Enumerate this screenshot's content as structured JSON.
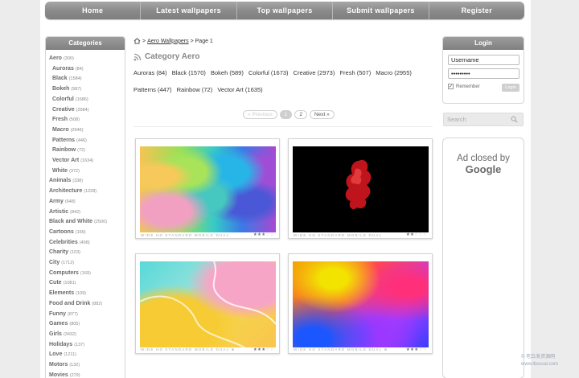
{
  "nav": [
    {
      "label": "Home"
    },
    {
      "label": "Latest wallpapers"
    },
    {
      "label": "Top wallpapers"
    },
    {
      "label": "Submit wallpapers"
    },
    {
      "label": "Register"
    }
  ],
  "categories": {
    "title": "Categories",
    "items": [
      {
        "label": "Aero",
        "count": "(300)",
        "sub": false
      },
      {
        "label": "Auroras",
        "count": "(84)",
        "sub": true
      },
      {
        "label": "Black",
        "count": "(1584)",
        "sub": true
      },
      {
        "label": "Bokeh",
        "count": "(587)",
        "sub": true
      },
      {
        "label": "Colorful",
        "count": "(1686)",
        "sub": true
      },
      {
        "label": "Creative",
        "count": "(2984)",
        "sub": true
      },
      {
        "label": "Fresh",
        "count": "(508)",
        "sub": true
      },
      {
        "label": "Macro",
        "count": "(2946)",
        "sub": true
      },
      {
        "label": "Patterns",
        "count": "(446)",
        "sub": true
      },
      {
        "label": "Rainbow",
        "count": "(72)",
        "sub": true
      },
      {
        "label": "Vector Art",
        "count": "(1634)",
        "sub": true
      },
      {
        "label": "White",
        "count": "(372)",
        "sub": true
      },
      {
        "label": "Animals",
        "count": "(338)",
        "sub": false
      },
      {
        "label": "Architecture",
        "count": "(1228)",
        "sub": false
      },
      {
        "label": "Army",
        "count": "(648)",
        "sub": false
      },
      {
        "label": "Artistic",
        "count": "(842)",
        "sub": false
      },
      {
        "label": "Black and White",
        "count": "(2500)",
        "sub": false
      },
      {
        "label": "Cartoons",
        "count": "(166)",
        "sub": false
      },
      {
        "label": "Celebrities",
        "count": "(498)",
        "sub": false
      },
      {
        "label": "Charity",
        "count": "(103)",
        "sub": false
      },
      {
        "label": "City",
        "count": "(1712)",
        "sub": false
      },
      {
        "label": "Computers",
        "count": "(169)",
        "sub": false
      },
      {
        "label": "Cute",
        "count": "(1081)",
        "sub": false
      },
      {
        "label": "Elements",
        "count": "(109)",
        "sub": false
      },
      {
        "label": "Food and Drink",
        "count": "(882)",
        "sub": false
      },
      {
        "label": "Funny",
        "count": "(877)",
        "sub": false
      },
      {
        "label": "Games",
        "count": "(805)",
        "sub": false
      },
      {
        "label": "Girls",
        "count": "(3432)",
        "sub": false
      },
      {
        "label": "Holidays",
        "count": "(137)",
        "sub": false
      },
      {
        "label": "Love",
        "count": "(1211)",
        "sub": false
      },
      {
        "label": "Motors",
        "count": "(132)",
        "sub": false
      },
      {
        "label": "Movies",
        "count": "(279)",
        "sub": false
      }
    ]
  },
  "breadcrumb": {
    "link": "Aero Wallpapers",
    "sep": ">",
    "page": "> Page 1"
  },
  "category_title": "Category Aero",
  "subcategories": [
    "Auroras (84)",
    "Black (1570)",
    "Bokeh (589)",
    "Colorful (1673)",
    "Creative (2973)",
    "Fresh (507)",
    "Macro (2955)",
    "Patterns (447)",
    "Rainbow (72)",
    "Vector Art (1635)"
  ],
  "pager": {
    "prev": "« Previous",
    "pages": [
      "1",
      "2"
    ],
    "next": "Next »"
  },
  "thumbnails": [
    {
      "meta": "WIDE  HD  STANDARD  MOBILE  DUAL",
      "rating": 3
    },
    {
      "meta": "WIDE  HD  STANDARD  MOBILE  DUAL",
      "rating": 2
    },
    {
      "meta": "WIDE  HD  STANDARD  MOBILE  DUAL  ⊕",
      "rating": 3
    },
    {
      "meta": "WIDE  HD  STANDARD  MOBILE  DUAL  ⊕",
      "rating": 3
    }
  ],
  "login": {
    "title": "Login",
    "username": "Username",
    "password": "•••••••••",
    "remember": "Remember",
    "button": "Login"
  },
  "search": {
    "placeholder": "Search"
  },
  "ad": {
    "line1": "Ad closed by",
    "line2": "Google"
  },
  "watermark": {
    "line1": "© 老白发资源网",
    "line2": "www.lbsucai.com"
  }
}
